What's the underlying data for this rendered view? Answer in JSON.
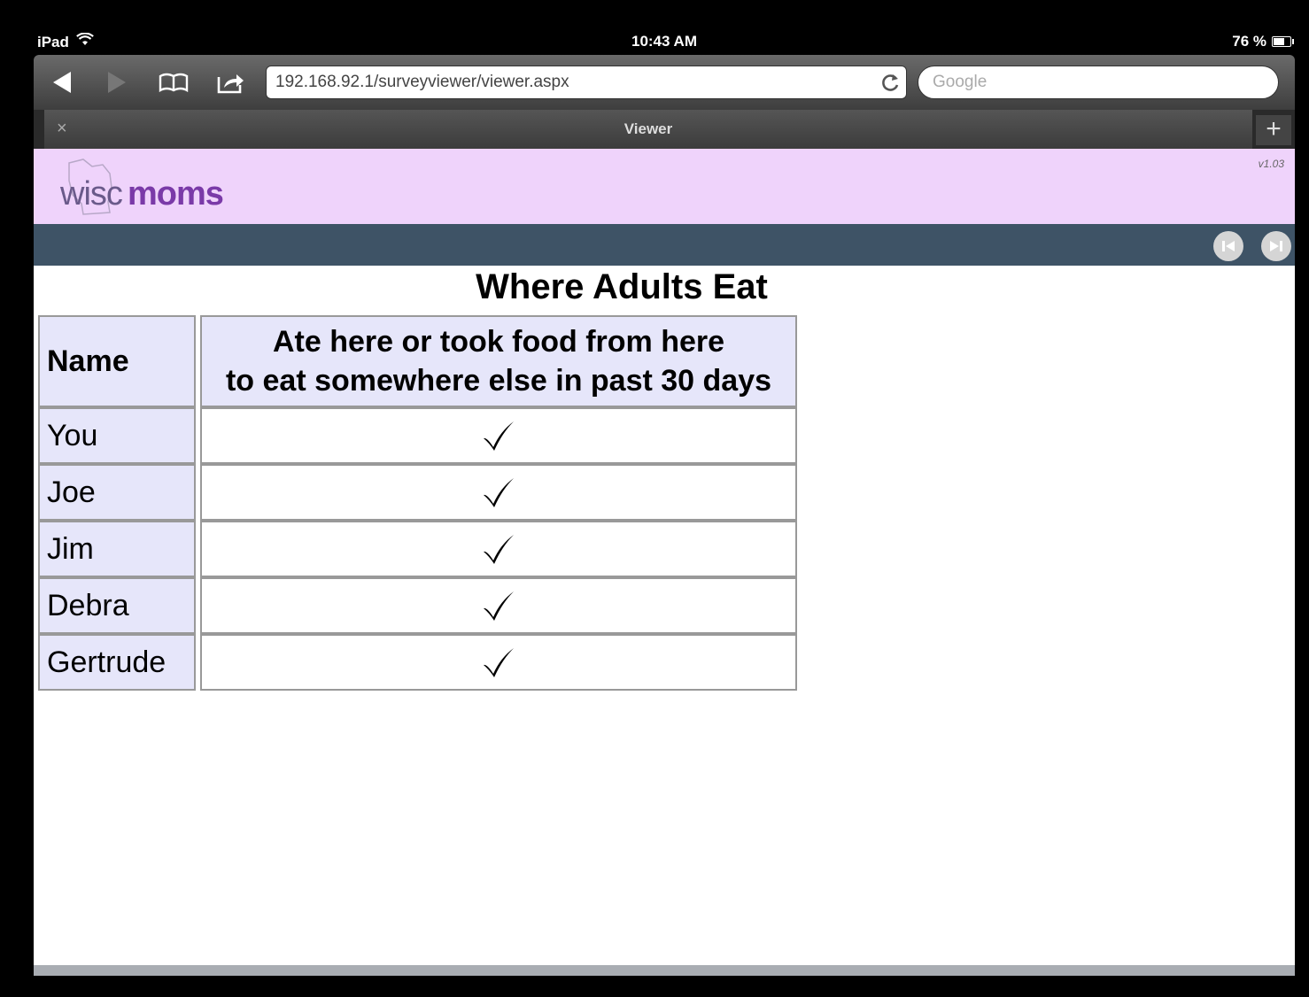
{
  "status_bar": {
    "device": "iPad",
    "time": "10:43 AM",
    "battery": "76 %",
    "battery_level": 0.76
  },
  "browser": {
    "url": "192.168.92.1/surveyviewer/viewer.aspx",
    "search_placeholder": "Google",
    "tab_title": "Viewer",
    "tab_close": "×",
    "new_tab": "+"
  },
  "site": {
    "logo_part1": "wisc",
    "logo_part2": "moms",
    "version": "v1.03"
  },
  "page": {
    "title": "Where Adults Eat",
    "table": {
      "headers": {
        "name": "Name",
        "ate_line1": "Ate here or took food from here",
        "ate_line2": "to eat somewhere else in past 30 days"
      },
      "rows": [
        {
          "name": "You",
          "checked": true
        },
        {
          "name": "Joe",
          "checked": true
        },
        {
          "name": "Jim",
          "checked": true
        },
        {
          "name": "Debra",
          "checked": true
        },
        {
          "name": "Gertrude",
          "checked": true
        }
      ]
    }
  },
  "icons": {
    "back": "back-arrow-icon",
    "forward": "forward-arrow-icon",
    "bookmarks": "bookmarks-book-icon",
    "share": "share-icon",
    "reload": "reload-icon",
    "first": "skip-to-first-icon",
    "last": "skip-to-last-icon"
  }
}
